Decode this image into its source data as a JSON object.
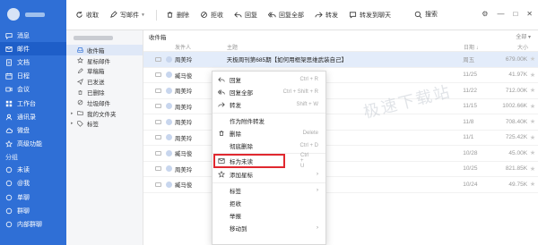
{
  "nav": {
    "items": [
      {
        "label": "消息",
        "icon": "message-icon",
        "active": false
      },
      {
        "label": "邮件",
        "icon": "mail-icon",
        "active": true
      },
      {
        "label": "文档",
        "icon": "doc-icon",
        "active": false
      },
      {
        "label": "日程",
        "icon": "calendar-icon",
        "active": false
      },
      {
        "label": "会议",
        "icon": "meeting-icon",
        "active": false
      },
      {
        "label": "工作台",
        "icon": "workbench-icon",
        "active": false
      },
      {
        "label": "通讯录",
        "icon": "contacts-icon",
        "active": false
      },
      {
        "label": "微盘",
        "icon": "drive-icon",
        "active": false
      },
      {
        "label": "高级功能",
        "icon": "advanced-icon",
        "active": false
      }
    ],
    "section_label": "分组",
    "groups": [
      {
        "label": "未读"
      },
      {
        "label": "@我"
      },
      {
        "label": "单聊"
      },
      {
        "label": "群聊"
      },
      {
        "label": "内部群聊"
      }
    ]
  },
  "toolbar": {
    "refresh": "收取",
    "compose": "写邮件",
    "delete": "删除",
    "reject": "拒收",
    "reply": "回复",
    "reply_all": "回复全部",
    "forward": "转发",
    "forward_chat": "转发到聊天",
    "search": "搜索"
  },
  "folders": [
    {
      "label": "收件箱",
      "selected": true,
      "icon": "inbox-icon"
    },
    {
      "label": "星标邮件",
      "selected": false,
      "icon": "star-icon"
    },
    {
      "label": "草稿箱",
      "selected": false,
      "icon": "draft-icon"
    },
    {
      "label": "已发送",
      "selected": false,
      "icon": "sent-icon"
    },
    {
      "label": "已删除",
      "selected": false,
      "icon": "trash-icon"
    },
    {
      "label": "垃圾邮件",
      "selected": false,
      "icon": "spam-icon"
    },
    {
      "label": "我的文件夹",
      "selected": false,
      "icon": "folder-icon",
      "expandable": true
    },
    {
      "label": "标签",
      "selected": false,
      "icon": "tag-icon",
      "expandable": true
    }
  ],
  "list": {
    "title": "收件箱",
    "filter": "全部",
    "columns": {
      "from": "发件人",
      "subject": "主题",
      "date": "日期",
      "size": "大小"
    },
    "rows": [
      {
        "from": "周美玲",
        "subject": "天极周刊第685期【如何用框架思维武装自己】",
        "date": "周五",
        "size": "679.00K",
        "highlight": true
      },
      {
        "from": "臧马俊",
        "subject": "",
        "date": "11/25",
        "size": "41.97K"
      },
      {
        "from": "周美玲",
        "subject": "思维】",
        "date": "11/22",
        "size": "712.00K"
      },
      {
        "from": "周美玲",
        "subject": "4个秘诀】",
        "date": "11/15",
        "size": "1002.66K"
      },
      {
        "from": "周美玲",
        "subject": "汇报】",
        "date": "11/8",
        "size": "708.40K"
      },
      {
        "from": "周美玲",
        "subject": "职业素养】",
        "date": "11/1",
        "size": "725.42K"
      },
      {
        "from": "臧马俊",
        "subject": "2024.10",
        "date": "10/28",
        "size": "45.00K"
      },
      {
        "from": "周美玲",
        "subject": "的方法】",
        "date": "10/25",
        "size": "821.85K"
      },
      {
        "from": "臧马俊",
        "subject": "",
        "date": "10/24",
        "size": "49.75K"
      }
    ]
  },
  "context_menu": {
    "items": [
      {
        "label": "回复",
        "shortcut": "Ctrl + R",
        "icon": "reply-icon"
      },
      {
        "label": "回复全部",
        "shortcut": "Ctrl + Shift + R",
        "icon": "reply-all-icon"
      },
      {
        "label": "转发",
        "shortcut": "Shift + W",
        "icon": "forward-icon"
      },
      {
        "label": "作为附件转发",
        "shortcut": "",
        "icon": ""
      },
      {
        "label": "删除",
        "shortcut": "Delete",
        "icon": "delete-icon"
      },
      {
        "label": "彻底删除",
        "shortcut": "Ctrl + D",
        "icon": ""
      },
      {
        "label": "标为未读",
        "shortcut": "Ctrl + U",
        "icon": "mark-unread-icon",
        "boxed": true
      },
      {
        "label": "添加星标",
        "shortcut": "",
        "icon": "star-icon",
        "submenu": true
      },
      {
        "label": "标签",
        "shortcut": "",
        "icon": "",
        "submenu": true
      },
      {
        "label": "拒收",
        "shortcut": "",
        "icon": ""
      },
      {
        "label": "举报",
        "shortcut": "",
        "icon": ""
      },
      {
        "label": "移动到",
        "shortcut": "",
        "icon": "",
        "submenu": true
      }
    ],
    "submenu_arrow": "›"
  },
  "watermark": "极速下载站",
  "colors": {
    "nav_bg": "#2f6fd6",
    "nav_active": "#1e5ec8",
    "highlight_row": "#e3ecfa",
    "boxed_outline": "#e0282f"
  }
}
